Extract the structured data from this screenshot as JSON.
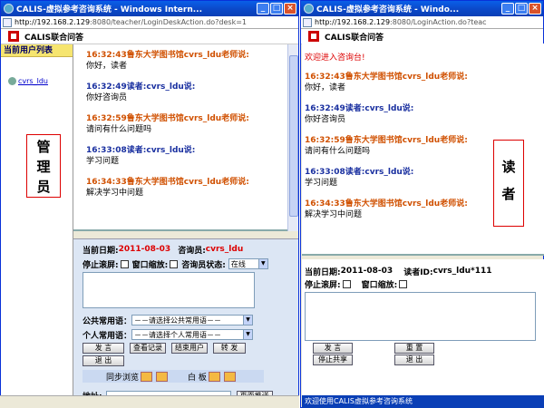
{
  "admin_window": {
    "title": "CALIS-虚拟参考咨询系统 - Windows Intern...",
    "url_host": "http://192.168.2.129",
    "url_path": ":8080/teacher/LoginDeskAction.do?desk=1",
    "brand": "CALIS联合问答",
    "user_list_header": "当前用户列表",
    "user": "cvrs_ldu",
    "label": [
      "管",
      "理",
      "员"
    ],
    "messages": [
      {
        "type": "teacher",
        "who": "16:32:43鲁东大学图书馆cvrs_ldu老师说:",
        "text": "你好，读者"
      },
      {
        "type": "reader",
        "who": "16:32:49读者:cvrs_ldu说:",
        "text": "你好咨询员"
      },
      {
        "type": "teacher",
        "who": "16:32:59鲁东大学图书馆cvrs_ldu老师说:",
        "text": "请问有什么问题吗"
      },
      {
        "type": "reader",
        "who": "16:33:08读者:cvrs_ldu说:",
        "text": "学习问题"
      },
      {
        "type": "teacher",
        "who": "16:34:33鲁东大学图书馆cvrs_ldu老师说:",
        "text": "解决学习中问题"
      }
    ],
    "form": {
      "date_label": "当前日期:",
      "date": "2011-08-03",
      "consultant_label": "咨询员:",
      "consultant": "cvrs_ldu",
      "stop_scroll": "停止滚屏:",
      "window_shrink": "窗口缩放:",
      "status_label": "咨询员状态:",
      "status_value": "在线",
      "public_phrase_label": "公共常用语：",
      "public_phrase": "－－请选择公共常用语－－",
      "private_phrase_label": "个人常用语：",
      "private_phrase": "－－请选择个人常用语－－",
      "btn_send": "发  言",
      "btn_history": "查看记录",
      "btn_end": "结束用户",
      "btn_forward": "转  发",
      "btn_exit": "退  出",
      "sync_browse": "同步浏览",
      "whiteboard": "白    板",
      "address_label": "地址:",
      "btn_push": "页面推送"
    }
  },
  "reader_window": {
    "title": "CALIS-虚拟参考咨询系统 - Windo...",
    "url_host": "http://192.168.2.129",
    "url_path": ":8080/LoginAction.do?teac",
    "brand": "CALIS联合问答",
    "welcome": "欢迎进入咨询台!",
    "label": [
      "读",
      "者"
    ],
    "messages": [
      {
        "type": "teacher",
        "who": "16:32:43鲁东大学图书馆cvrs_ldu老师说:",
        "text": "你好，读者"
      },
      {
        "type": "reader",
        "who": "16:32:49读者:cvrs_ldu说:",
        "text": "你好咨询员"
      },
      {
        "type": "teacher",
        "who": "16:32:59鲁东大学图书馆cvrs_ldu老师说:",
        "text": "请问有什么问题吗"
      },
      {
        "type": "reader",
        "who": "16:33:08读者:cvrs_ldu说:",
        "text": "学习问题"
      },
      {
        "type": "teacher",
        "who": "16:34:33鲁东大学图书馆cvrs_ldu老师说:",
        "text": "解决学习中问题"
      }
    ],
    "form": {
      "date_label": "当前日期:",
      "date": "2011-08-03",
      "reader_id_label": "读者ID:",
      "reader_id": "cvrs_ldu*111",
      "stop_scroll": "停止滚屏:",
      "window_shrink": "窗口缩放:",
      "btn_send": "发  言",
      "btn_reset": "重  置",
      "btn_stop_share": "停止共享",
      "btn_exit": "退  出"
    },
    "status_text": "欢迎使用CALIS虚拟参考咨询系统"
  }
}
